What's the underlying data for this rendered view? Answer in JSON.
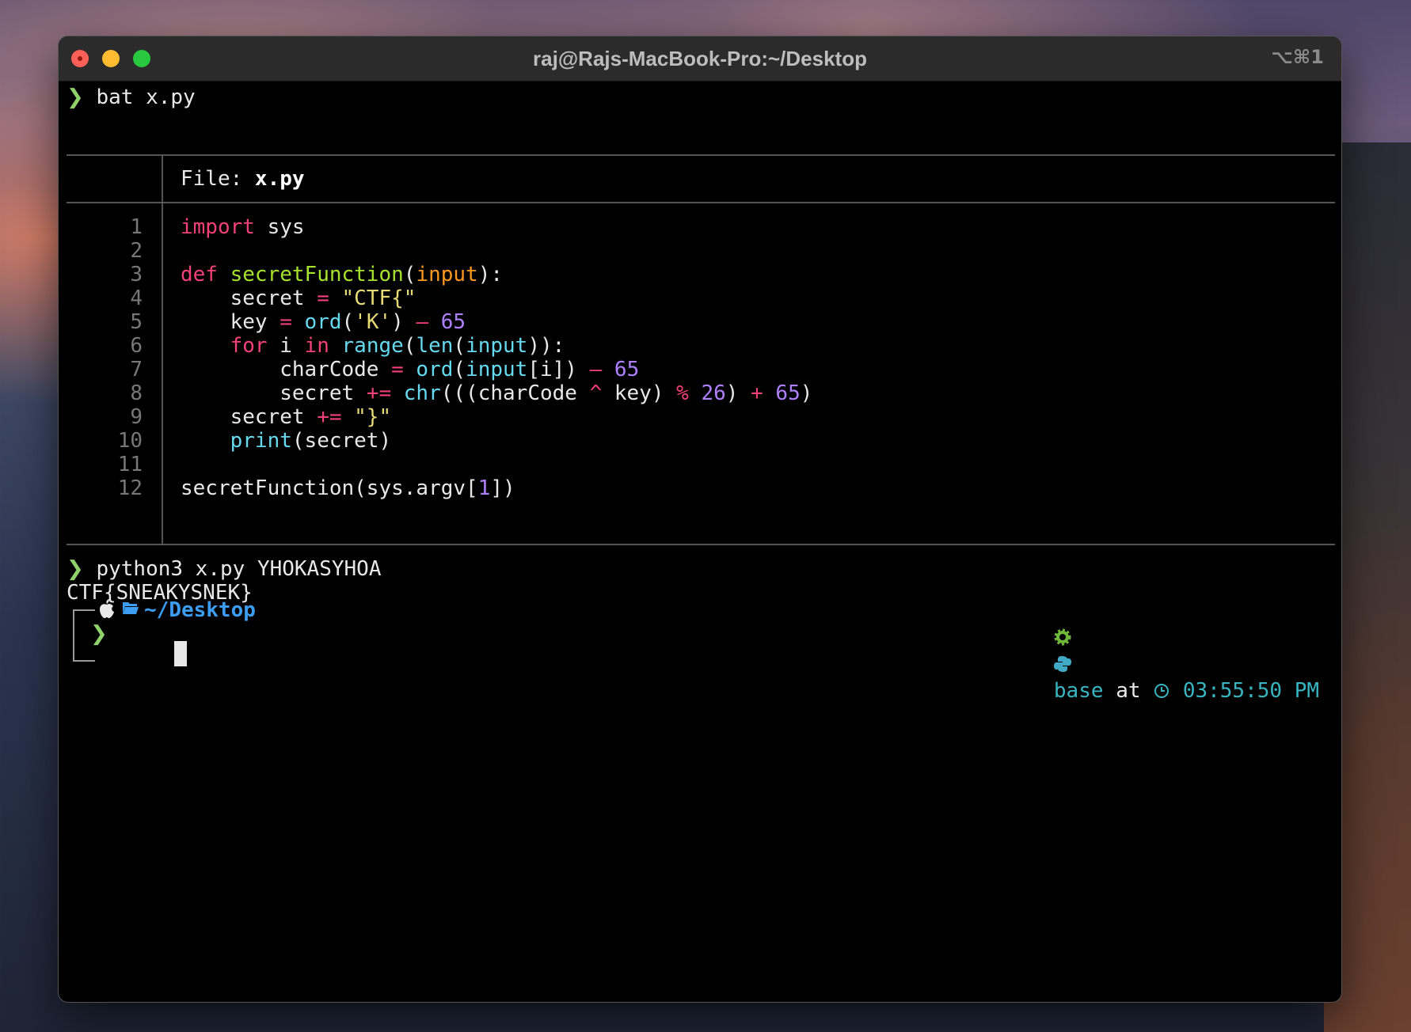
{
  "window": {
    "title": "raj@Rajs-MacBook-Pro:~/Desktop",
    "shortcut": "⌥⌘1"
  },
  "terminal": {
    "prompt_symbol": "❯",
    "cmd1": "bat x.py",
    "file_label": "File: ",
    "file_name": "x.py",
    "code_lines": [
      {
        "n": "1"
      },
      {
        "n": "2"
      },
      {
        "n": "3"
      },
      {
        "n": "4"
      },
      {
        "n": "5"
      },
      {
        "n": "6"
      },
      {
        "n": "7"
      },
      {
        "n": "8"
      },
      {
        "n": "9"
      },
      {
        "n": "10"
      },
      {
        "n": "11"
      },
      {
        "n": "12"
      }
    ],
    "code": {
      "l1_import": "import",
      "l1_rest": " sys",
      "l3_def": "def",
      "l3_name": " secretFunction",
      "l3_open": "(",
      "l3_param": "input",
      "l3_close": "):",
      "l4_a": "    secret ",
      "l4_op": "=",
      "l4_str": " \"CTF{\"",
      "l5_a": "    key ",
      "l5_op": "=",
      "l5_bi": " ord",
      "l5_b": "(",
      "l5_str": "'K'",
      "l5_c": ") ",
      "l5_op2": "–",
      "l5_num": " 65",
      "l6_for": "    for",
      "l6_i": " i ",
      "l6_in": "in",
      "l6_range": " range",
      "l6_a": "(",
      "l6_len": "len",
      "l6_b": "(",
      "l6_input": "input",
      "l6_c": ")):",
      "l7_a": "        charCode ",
      "l7_op": "=",
      "l7_bi": " ord",
      "l7_b": "(",
      "l7_input": "input",
      "l7_c": "[i]) ",
      "l7_op2": "–",
      "l7_num": " 65",
      "l8_a": "        secret ",
      "l8_op": "+=",
      "l8_bi": " chr",
      "l8_b": "(((charCode ",
      "l8_op2": "^",
      "l8_c": " key) ",
      "l8_op3": "%",
      "l8_num": " 26",
      "l8_d": ") ",
      "l8_op4": "+",
      "l8_num2": " 65",
      "l8_e": ")",
      "l9_a": "    secret ",
      "l9_op": "+=",
      "l9_str": " \"}\"",
      "l10_bi": "    print",
      "l10_rest": "(secret)",
      "l12_a": "secretFunction(sys.argv[",
      "l12_num": "1",
      "l12_b": "])"
    },
    "cmd2": "python3 x.py YHOKASYHOA",
    "output": "CTF{SNEAKYSNEK}",
    "path_prefix": "~/",
    "path_dir": "Desktop",
    "env_name": "base",
    "at_label": "at",
    "time": "03:55:50 PM"
  },
  "colors": {
    "prompt": "#8fd16a",
    "keyword": "#f2407a",
    "function": "#a6e22e",
    "string": "#e6db74",
    "number": "#ae81ff",
    "builtin": "#66d9ef",
    "directory": "#3c9df2"
  },
  "icons": [
    "apple-icon",
    "folder-icon",
    "gear-icon",
    "python-icon",
    "clock-icon"
  ]
}
